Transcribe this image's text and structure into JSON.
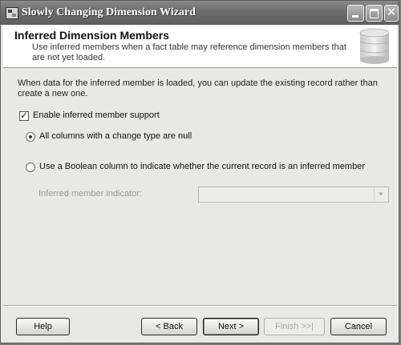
{
  "window": {
    "title": "Slowly Changing Dimension Wizard"
  },
  "header": {
    "title": "Inferred Dimension Members",
    "description": "Use inferred members when a fact table may reference dimension members that are not yet loaded."
  },
  "main": {
    "info_text": "When data for the inferred member is loaded, you can update the existing record rather than create a new one.",
    "enable_checkbox": {
      "label": "Enable inferred member support",
      "checked": true
    },
    "options": [
      {
        "label": "All columns with a change type are null",
        "selected": true
      },
      {
        "label": "Use a Boolean column to indicate whether the current record is an inferred member",
        "selected": false
      }
    ],
    "indicator": {
      "label": "Inferred member indicator:",
      "value": "",
      "enabled": false
    }
  },
  "footer": {
    "help_label": "Help",
    "back_label": "< Back",
    "next_label": "Next >",
    "finish_label": "Finish >>|",
    "cancel_label": "Cancel"
  },
  "icons": {
    "app": "wizard-app-icon",
    "header": "database-icon",
    "minimize": "minimize-icon",
    "maximize": "maximize-icon",
    "close": "close-icon",
    "dropdown": "chevron-down-icon"
  }
}
